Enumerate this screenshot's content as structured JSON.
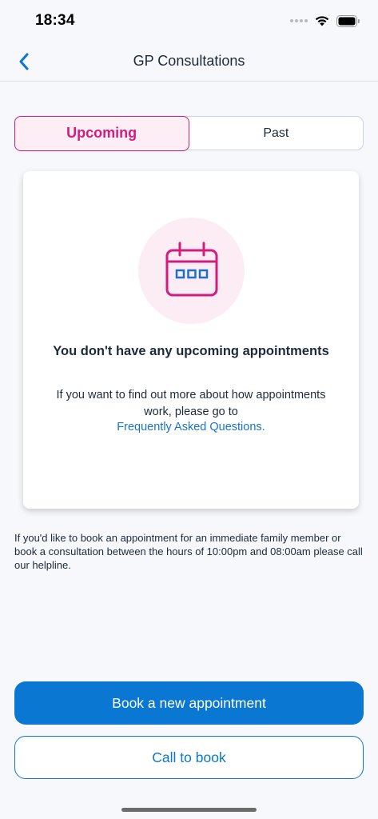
{
  "status_bar": {
    "time": "18:34",
    "icons": [
      "signal-dots-icon",
      "wifi-icon",
      "battery-icon"
    ]
  },
  "nav": {
    "title": "GP Consultations",
    "back_icon": "chevron-left-icon"
  },
  "tabs": [
    {
      "label": "Upcoming",
      "selected": true
    },
    {
      "label": "Past",
      "selected": false
    }
  ],
  "empty_state": {
    "icon": "calendar-icon",
    "title": "You don't have any upcoming appointments",
    "body": "If you want to find out more about how appointments work, please go to",
    "link": "Frequently Asked Questions."
  },
  "helpline_note": "If you'd like to book an appointment for an immediate family member or book a consultation between the hours of 10:00pm and 08:00am please call our helpline.",
  "actions": {
    "book": "Book a new appointment",
    "call": "Call to book"
  },
  "colors": {
    "accent_pink": "#d41c7c",
    "primary_blue": "#0a77d3",
    "link_blue": "#1a73c8",
    "background": "#f6f8fb"
  }
}
